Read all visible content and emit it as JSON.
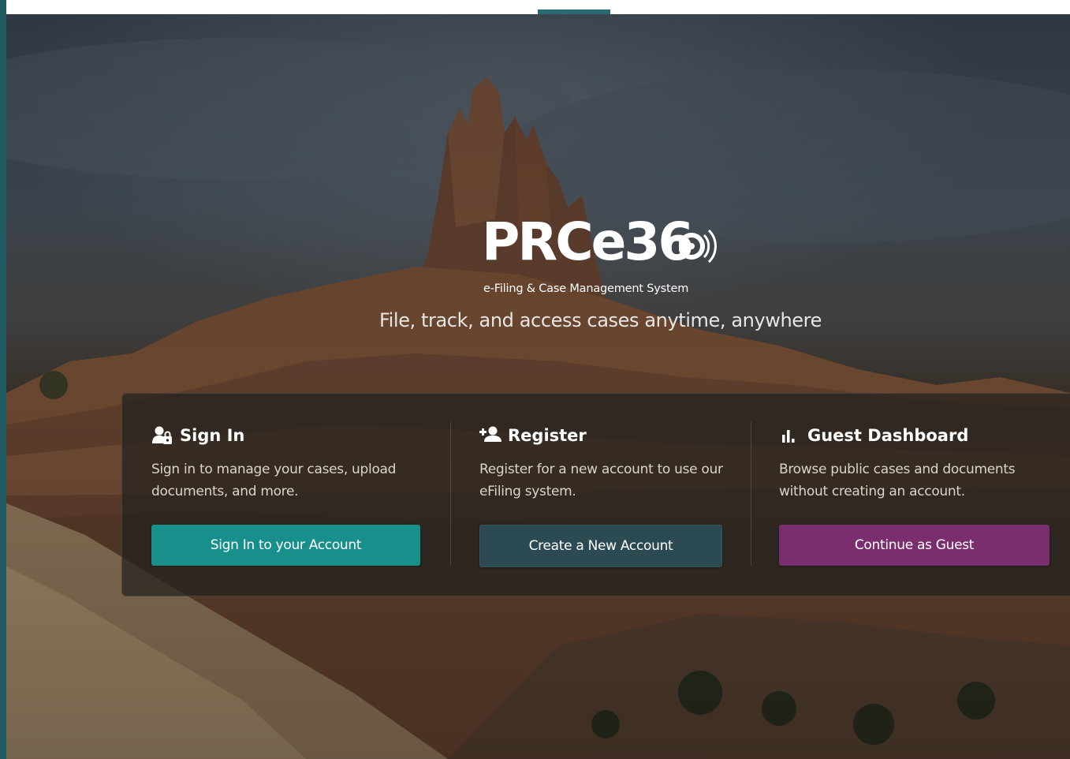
{
  "brand": {
    "logo_text": "PRCe36",
    "subtitle": "e-Filing & Case Management System"
  },
  "tagline": "File, track, and access cases anytime, anywhere",
  "options": [
    {
      "icon": "user-lock-icon",
      "title": "Sign In",
      "description": "Sign in to manage your cases, upload documents, and more.",
      "button_label": "Sign In to your Account",
      "button_color": "#17908b"
    },
    {
      "icon": "user-plus-icon",
      "title": "Register",
      "description": "Register for a new account to use our eFiling system.",
      "button_label": "Create a New Account",
      "button_color": "#2c4a52"
    },
    {
      "icon": "bar-chart-icon",
      "title": "Guest Dashboard",
      "description": "Browse public cases and documents without creating an account.",
      "button_label": "Continue as Guest",
      "button_color": "#7b2e6e"
    }
  ]
}
